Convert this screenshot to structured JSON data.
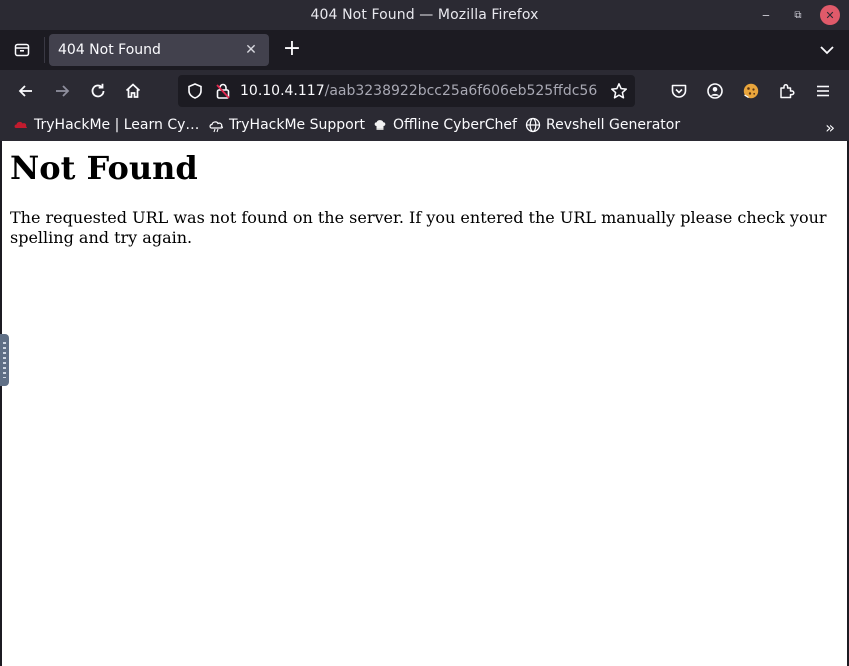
{
  "window": {
    "title": "404 Not Found — Mozilla Firefox",
    "controls": {
      "minimize": "‒",
      "restore": "⧉",
      "close": "✕"
    }
  },
  "tabs": [
    {
      "label": "404 Not Found",
      "active": true
    }
  ],
  "tab_strip": {
    "new_tab": "+",
    "close": "✕"
  },
  "navbar": {
    "url_host": "10.10.4.117",
    "url_path": "/aab3238922bcc25a6f606eb525ffdc56",
    "icons": [
      "back-icon",
      "forward-icon",
      "reload-icon",
      "home-icon",
      "shield-icon",
      "insecure-lock-icon",
      "star-icon",
      "pocket-icon",
      "account-icon",
      "cookie-extension-icon",
      "extensions-icon",
      "menu-icon"
    ]
  },
  "bookmarks": [
    {
      "label": "TryHackMe | Learn Cy…",
      "icon": "tryhackme-icon"
    },
    {
      "label": "TryHackMe Support",
      "icon": "support-icon"
    },
    {
      "label": "Offline CyberChef",
      "icon": "chef-icon"
    },
    {
      "label": "Revshell Generator",
      "icon": "globe-icon"
    }
  ],
  "bookmarks_overflow": "»",
  "page": {
    "heading": "Not Found",
    "message": "The requested URL was not found on the server. If you entered the URL manually please check your spelling and try again."
  },
  "colors": {
    "chrome_dark": "#1c1b22",
    "chrome": "#2b2a33",
    "tab_active": "#42414d",
    "close_button": "#e05a6a",
    "content_bg": "#ffffff"
  }
}
